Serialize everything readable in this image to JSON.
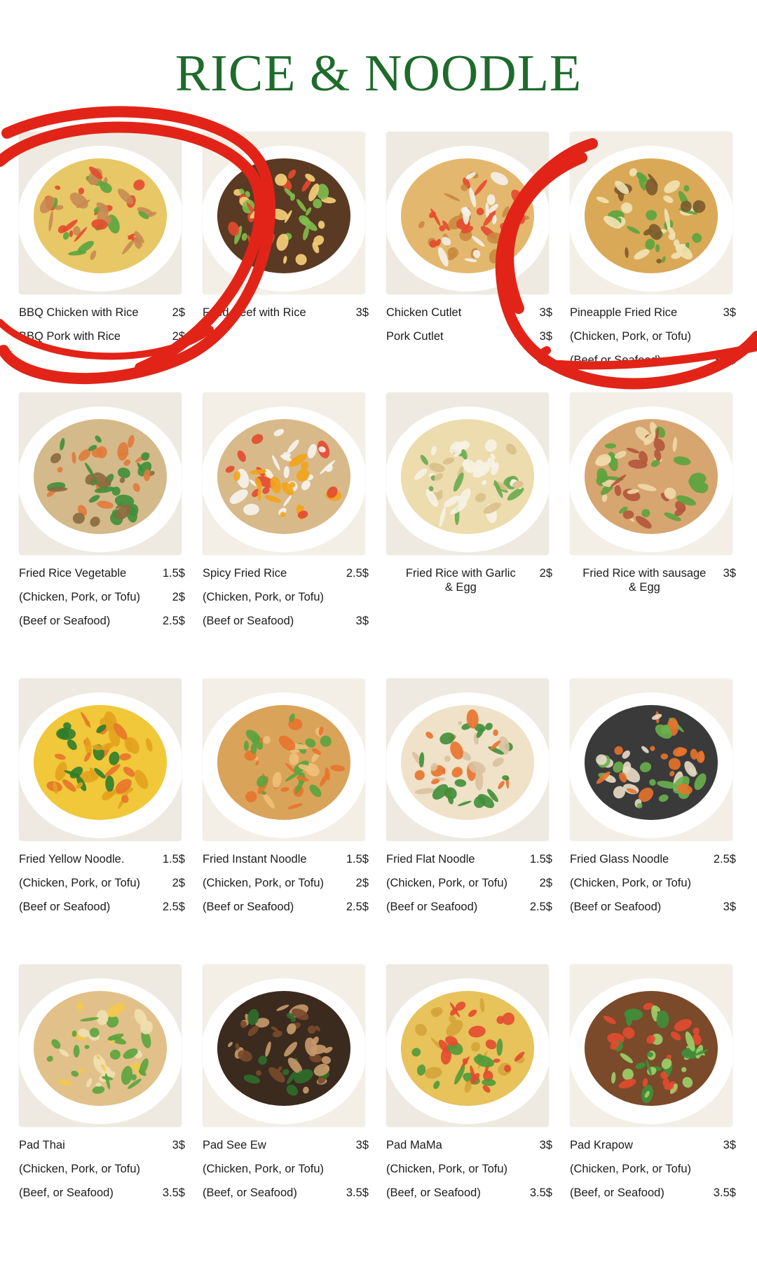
{
  "title": "RICE & NOODLE",
  "colors": {
    "title": "#1e6b2b",
    "circle": "#e22418"
  },
  "items": [
    {
      "icon": "bbq-chicken-rice-photo",
      "palette": [
        "#e8c766",
        "#c98a52",
        "#e44a2f",
        "#5aa43e"
      ],
      "lines": [
        {
          "name": "BBQ Chicken with Rice",
          "price": "2$"
        },
        {
          "name": "BBQ Pork with Rice",
          "price": "2$"
        }
      ]
    },
    {
      "icon": "fried-beef-rice-photo",
      "palette": [
        "#5a3a22",
        "#7fbf4d",
        "#e44a2f",
        "#f6d27a"
      ],
      "lines": [
        {
          "name": "Fried Beef with Rice",
          "price": "3$"
        }
      ]
    },
    {
      "icon": "chicken-cutlet-photo",
      "palette": [
        "#e3b86e",
        "#c98a3f",
        "#e44a2f",
        "#f4f1ea"
      ],
      "lines": [
        {
          "name": "Chicken Cutlet",
          "price": "3$"
        },
        {
          "name": "Pork Cutlet",
          "price": "3$"
        }
      ]
    },
    {
      "icon": "pineapple-fried-rice-photo",
      "palette": [
        "#d9a957",
        "#7c5a2c",
        "#5aa43e",
        "#f1e2b4"
      ],
      "lines": [
        {
          "name": "Pineapple Fried Rice",
          "price": "3$"
        },
        {
          "name": "(Chicken, Pork, or Tofu)",
          "price": ""
        },
        {
          "name": "(Beef or Seafood)",
          "price": "3.5$"
        }
      ]
    },
    {
      "icon": "fried-rice-vegetable-photo",
      "palette": [
        "#d4b98a",
        "#8a6a3f",
        "#3f8f3a",
        "#e07b3a"
      ],
      "lines": [
        {
          "name": "Fried Rice Vegetable",
          "price": "1.5$"
        },
        {
          "name": "(Chicken, Pork, or Tofu)",
          "price": "2$"
        },
        {
          "name": "(Beef or Seafood)",
          "price": "2.5$"
        }
      ]
    },
    {
      "icon": "spicy-fried-rice-photo",
      "palette": [
        "#d8b98a",
        "#f7f4ee",
        "#f2a41a",
        "#e44a2f"
      ],
      "lines": [
        {
          "name": "Spicy Fried Rice",
          "price": "2.5$"
        },
        {
          "name": "(Chicken, Pork, or Tofu)",
          "price": ""
        },
        {
          "name": "(Beef or Seafood)",
          "price": "3$"
        }
      ]
    },
    {
      "icon": "fried-rice-garlic-egg-photo",
      "palette": [
        "#ecdcae",
        "#d9c08a",
        "#6aa84f",
        "#f7f2e4"
      ],
      "lines": [
        {
          "name": "Fried Rice with Garlic\n& Egg",
          "price": "2$",
          "wrap": true
        }
      ]
    },
    {
      "icon": "fried-rice-sausage-egg-photo",
      "palette": [
        "#d7a56f",
        "#b2573a",
        "#5aa43e",
        "#f0d9a8"
      ],
      "lines": [
        {
          "name": "Fried Rice with sausage\n& Egg",
          "price": "3$",
          "wrap": true
        }
      ]
    },
    {
      "icon": "fried-yellow-noodle-photo",
      "palette": [
        "#f0c83a",
        "#e2a21e",
        "#2f7d2c",
        "#e8732c"
      ],
      "lines": [
        {
          "name": "Fried Yellow Noodle.",
          "price": "1.5$"
        },
        {
          "name": "(Chicken, Pork, or Tofu)",
          "price": "2$"
        },
        {
          "name": "(Beef or Seafood)",
          "price": "2.5$"
        }
      ]
    },
    {
      "icon": "fried-instant-noodle-photo",
      "palette": [
        "#d9a35a",
        "#f0c07a",
        "#5aa43e",
        "#e8732c"
      ],
      "lines": [
        {
          "name": "Fried Instant Noodle",
          "price": "1.5$"
        },
        {
          "name": "(Chicken, Pork, or Tofu)",
          "price": "2$"
        },
        {
          "name": "(Beef or Seafood)",
          "price": "2.5$"
        }
      ]
    },
    {
      "icon": "fried-flat-noodle-photo",
      "palette": [
        "#efe2c8",
        "#d8c2a0",
        "#3f8f3a",
        "#e8732c"
      ],
      "lines": [
        {
          "name": "Fried Flat Noodle",
          "price": "1.5$"
        },
        {
          "name": "(Chicken, Pork, or Tofu)",
          "price": "2$"
        },
        {
          "name": "(Beef or Seafood)",
          "price": "2.5$"
        }
      ]
    },
    {
      "icon": "fried-glass-noodle-photo",
      "palette": [
        "#3a3a3a",
        "#e9ddc6",
        "#e8732c",
        "#6ab04c"
      ],
      "lines": [
        {
          "name": "Fried Glass Noodle",
          "price": "2.5$"
        },
        {
          "name": "(Chicken, Pork, or Tofu)",
          "price": ""
        },
        {
          "name": "(Beef or Seafood)",
          "price": "3$"
        }
      ]
    },
    {
      "icon": "pad-thai-photo",
      "palette": [
        "#e2c08a",
        "#f0e0b0",
        "#5aa43e",
        "#f2c94c"
      ],
      "lines": [
        {
          "name": "Pad Thai",
          "price": "3$"
        },
        {
          "name": "(Chicken, Pork, or Tofu)",
          "price": ""
        },
        {
          "name": "(Beef, or Seafood)",
          "price": "3.5$"
        }
      ]
    },
    {
      "icon": "pad-see-ew-photo",
      "palette": [
        "#3b2a1e",
        "#7a4a2a",
        "#2f6d2a",
        "#c89a6a"
      ],
      "lines": [
        {
          "name": "Pad See Ew",
          "price": "3$"
        },
        {
          "name": "(Chicken, Pork, or Tofu)",
          "price": ""
        },
        {
          "name": "(Beef, or Seafood)",
          "price": "3.5$"
        }
      ]
    },
    {
      "icon": "pad-mama-photo",
      "palette": [
        "#e8c25a",
        "#d4a43a",
        "#4f9a3a",
        "#e44a2f"
      ],
      "lines": [
        {
          "name": "Pad MaMa",
          "price": "3$"
        },
        {
          "name": "(Chicken, Pork, or Tofu)",
          "price": ""
        },
        {
          "name": "(Beef, or Seafood)",
          "price": "3.5$"
        }
      ]
    },
    {
      "icon": "pad-krapow-photo",
      "palette": [
        "#7a4a2a",
        "#3f8f3a",
        "#9fd06a",
        "#e44a2f"
      ],
      "lines": [
        {
          "name": "Pad Krapow",
          "price": "3$"
        },
        {
          "name": "(Chicken, Pork, or Tofu)",
          "price": ""
        },
        {
          "name": "(Beef, or Seafood)",
          "price": "3.5$"
        }
      ]
    }
  ]
}
